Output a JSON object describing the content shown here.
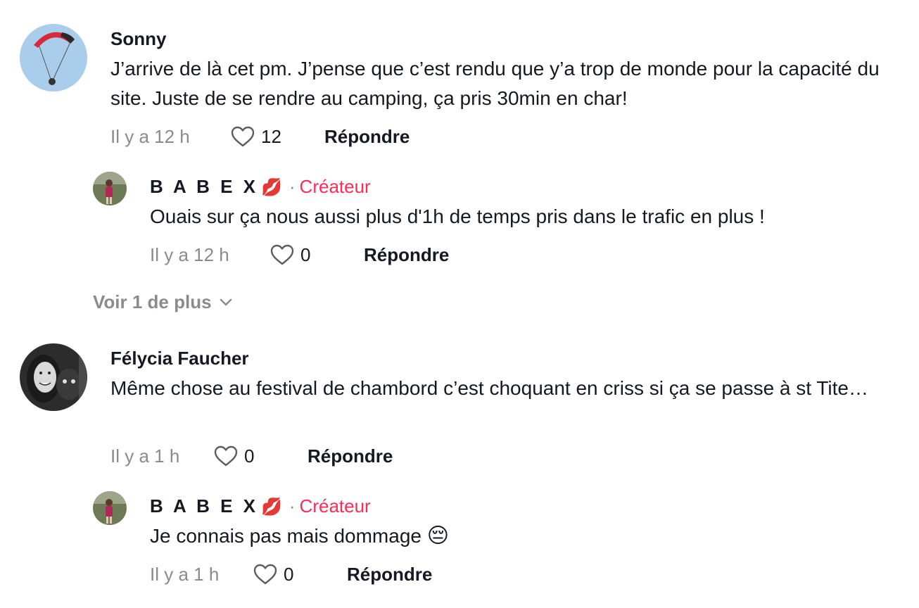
{
  "comments": [
    {
      "author": "Sonny",
      "text": "J’arrive de là cet pm. J’pense que c’est rendu que y’a trop de monde pour la capacité du site. Juste de se rendre au camping, ça pris 30min en char!",
      "time": "Il y a 12 h",
      "likes": "12",
      "reply_label": "Répondre",
      "replies": [
        {
          "author": "B A B E X",
          "author_emoji": "💋",
          "tag": "Créateur",
          "text": "Ouais sur ça nous aussi plus d'1h de temps pris dans le trafic en plus !",
          "time": "Il y a 12 h",
          "likes": "0",
          "reply_label": "Répondre"
        }
      ],
      "more_label": "Voir 1 de plus"
    },
    {
      "author": "Félycia Faucher",
      "text": "Même chose au festival de chambord c’est choquant en criss si ça se passe à st Tite…",
      "time": "Il y a 1 h",
      "likes": "0",
      "reply_label": "Répondre",
      "replies": [
        {
          "author": "B A B E X",
          "author_emoji": "💋",
          "tag": "Créateur",
          "text": "Je connais pas mais dommage",
          "text_emoji": "😔",
          "time": "Il y a 1 h",
          "likes": "0",
          "reply_label": "Répondre"
        }
      ]
    }
  ],
  "colors": {
    "text": "#161823",
    "muted": "#8a8b91",
    "creator": "#fe2c55"
  },
  "icons": {
    "like": "heart-outline-icon",
    "expand": "chevron-down-icon"
  }
}
